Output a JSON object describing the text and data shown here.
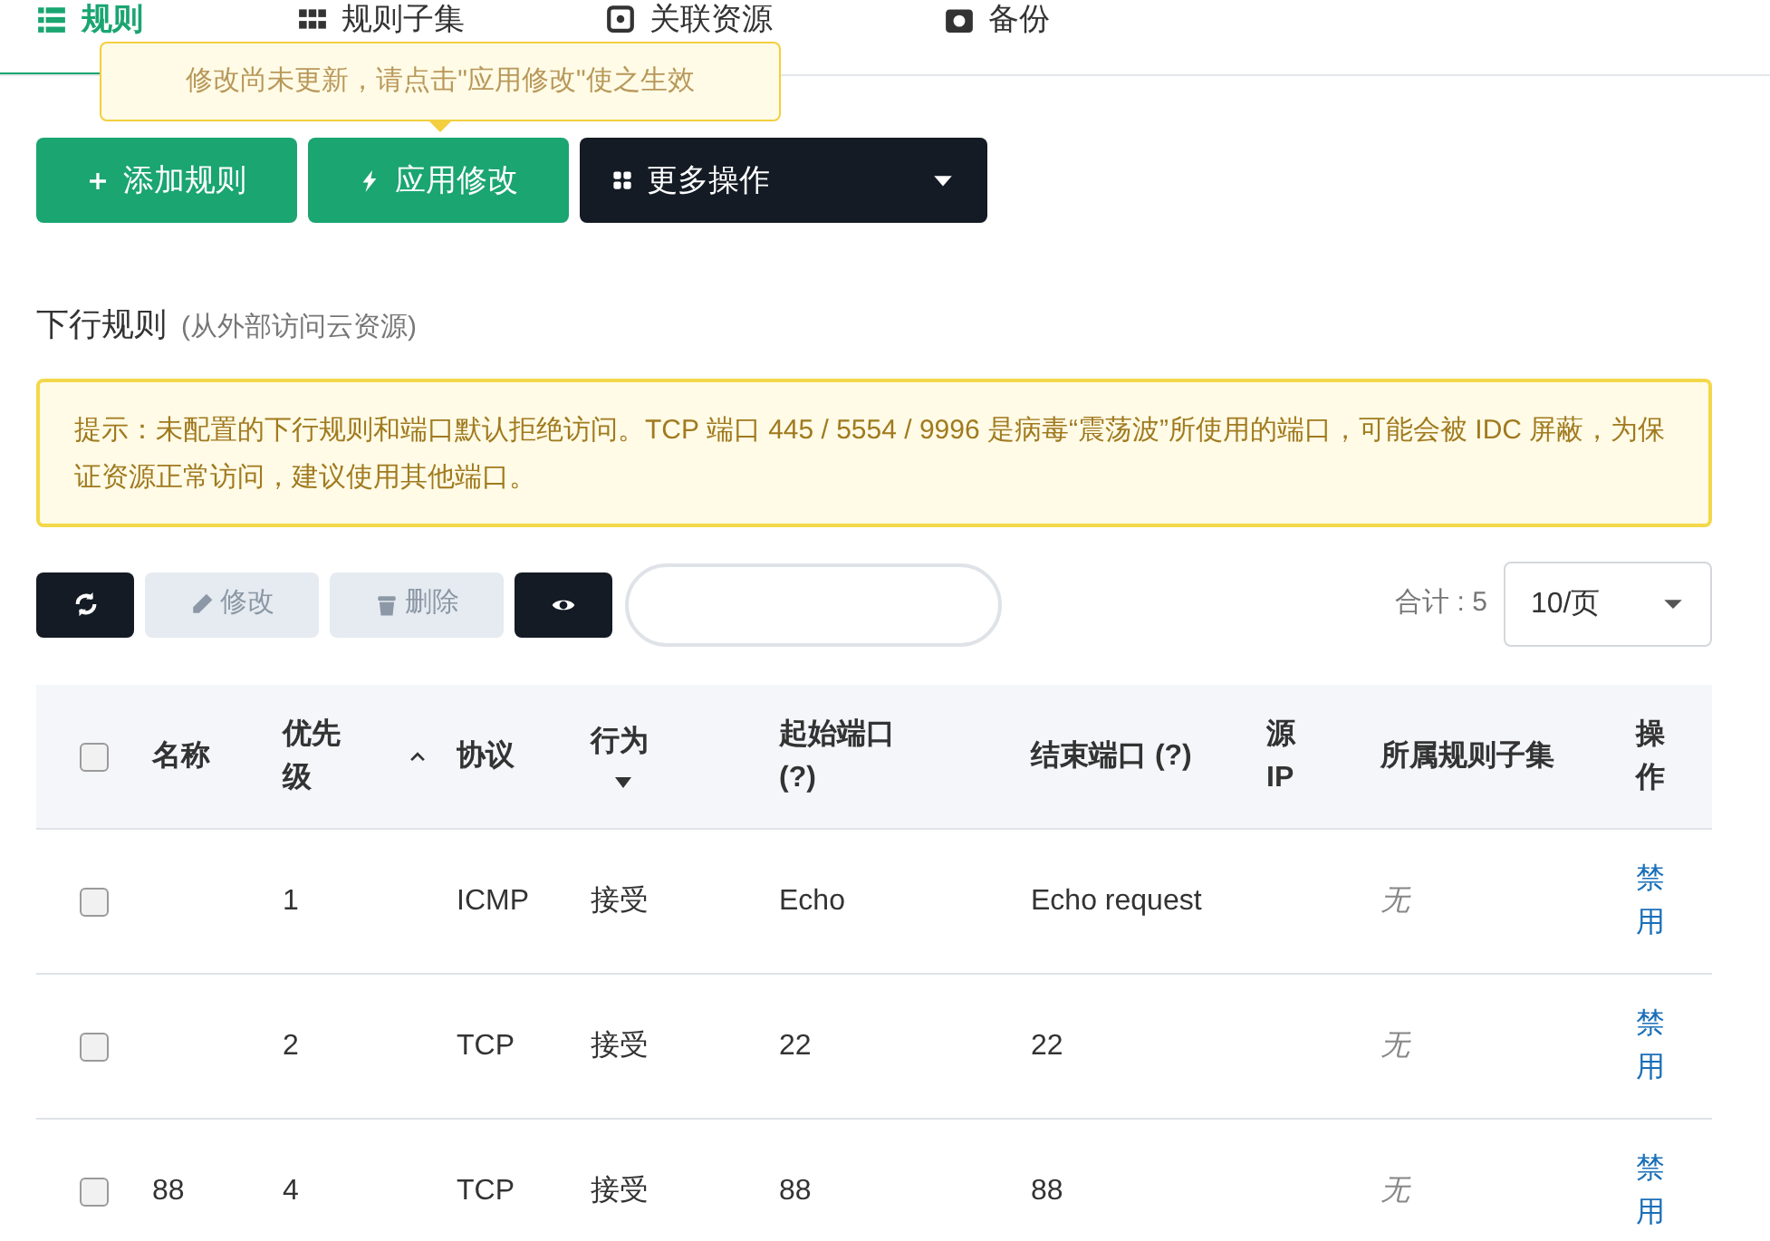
{
  "tabs": [
    {
      "label": "规则",
      "kind": "list",
      "selected": true
    },
    {
      "label": "规则子集",
      "kind": "grid",
      "selected": false
    },
    {
      "label": "关联资源",
      "kind": "link",
      "selected": false
    },
    {
      "label": "备份",
      "kind": "camera",
      "selected": false
    }
  ],
  "tooltip": "修改尚未更新，请点击\"应用修改\"使之生效",
  "actions": [
    {
      "label": "添加规则",
      "kind": "add"
    },
    {
      "label": "应用修改",
      "kind": "apply"
    },
    {
      "label": "更多操作",
      "kind": "more"
    }
  ],
  "section": {
    "title": "下行规则",
    "subtitle": "(从外部访问云资源)"
  },
  "alert": "提示：未配置的下行规则和端口默认拒绝访问。TCP 端口 445 / 5554 / 9996 是病毒“震荡波”所使用的端口，可能会被 IDC 屏蔽，为保证资源正常访问，建议使用其他端口。",
  "toolbar": [
    {
      "kind": "refresh",
      "disabled": false
    },
    {
      "kind": "edit",
      "label": "修改",
      "disabled": true
    },
    {
      "kind": "delete",
      "label": "删除",
      "disabled": true
    },
    {
      "kind": "view",
      "disabled": false
    }
  ],
  "total": "合计 : 5",
  "page_size": "10/页",
  "table": {
    "select_all": {
      "checked": false
    },
    "columns": [
      {
        "label": "名称"
      },
      {
        "label": "优先级",
        "kind": "sortable"
      },
      {
        "label": "协议"
      },
      {
        "label": "行为",
        "kind": "filter"
      },
      {
        "label": "起始端口 (?)"
      },
      {
        "label": "结束端口 (?)"
      },
      {
        "label": "源IP"
      },
      {
        "label": "所属规则子集"
      },
      {
        "label": "操作"
      }
    ],
    "rows": [
      {
        "checked": false,
        "priority": "1",
        "protocol": "ICMP",
        "action": "接受",
        "start_port": "Echo",
        "end_port": "Echo request",
        "subset": "无",
        "operation": "禁用"
      },
      {
        "checked": false,
        "priority": "2",
        "protocol": "TCP",
        "action": "接受",
        "start_port": "22",
        "end_port": "22",
        "subset": "无",
        "operation": "禁用"
      },
      {
        "checked": false,
        "name": "88",
        "priority": "4",
        "protocol": "TCP",
        "action": "接受",
        "start_port": "88",
        "end_port": "88",
        "subset": "无",
        "operation": "禁用"
      }
    ]
  }
}
